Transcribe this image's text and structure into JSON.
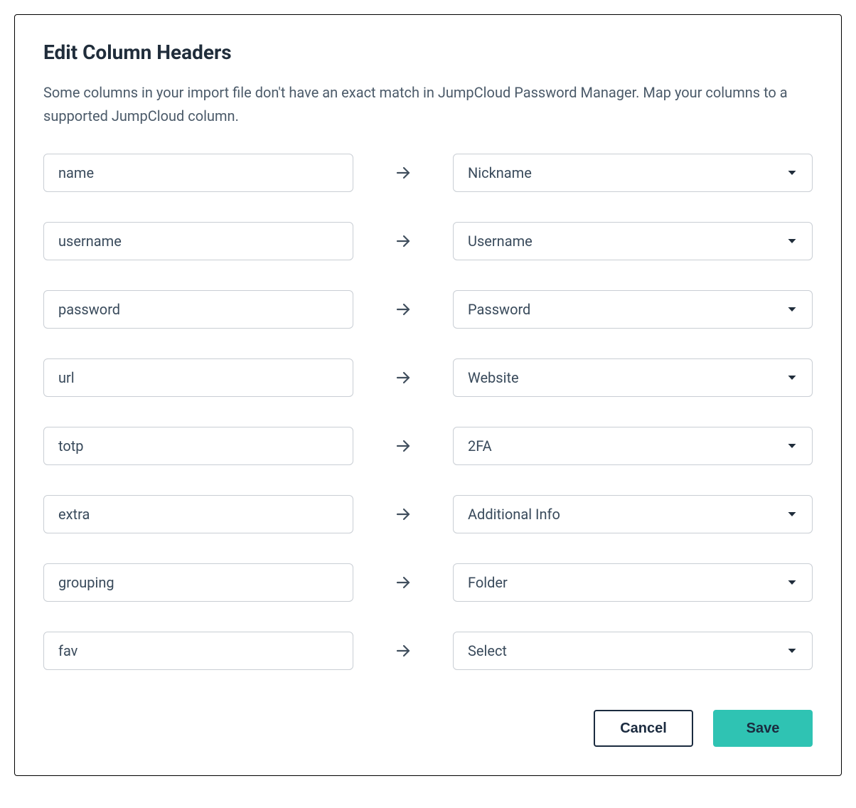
{
  "dialog": {
    "title": "Edit Column Headers",
    "description": "Some columns in your import file don't have an exact match in JumpCloud Password Manager. Map your columns to a supported JumpCloud column."
  },
  "mappings": [
    {
      "source": "name",
      "target": "Nickname"
    },
    {
      "source": "username",
      "target": "Username"
    },
    {
      "source": "password",
      "target": "Password"
    },
    {
      "source": "url",
      "target": "Website"
    },
    {
      "source": "totp",
      "target": "2FA"
    },
    {
      "source": "extra",
      "target": "Additional Info"
    },
    {
      "source": "grouping",
      "target": "Folder"
    },
    {
      "source": "fav",
      "target": "Select"
    }
  ],
  "actions": {
    "cancel_label": "Cancel",
    "save_label": "Save"
  }
}
